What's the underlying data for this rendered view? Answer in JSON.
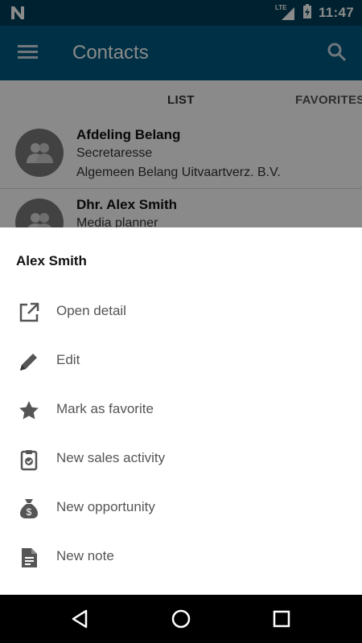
{
  "status_bar": {
    "network_type": "LTE",
    "time": "11:47",
    "icons": [
      "n-notification-icon",
      "signal-lte-icon",
      "battery-charging-icon"
    ]
  },
  "app_bar": {
    "title": "Contacts",
    "background": "#005a80",
    "icons": [
      "menu-icon",
      "search-icon"
    ]
  },
  "tabs": [
    {
      "label": "LIST",
      "selected": true
    },
    {
      "label": "FAVORITES",
      "selected": false
    }
  ],
  "contacts": [
    {
      "name": "Afdeling Belang",
      "role": "Secretaresse",
      "company": "Algemeen Belang Uitvaartverz. B.V."
    },
    {
      "name": "Dhr. Alex Smith",
      "role": "Media planner"
    }
  ],
  "bottom_sheet": {
    "title": "Alex Smith",
    "actions": [
      {
        "label": "Open detail",
        "icon": "open-external-icon"
      },
      {
        "label": "Edit",
        "icon": "pencil-icon"
      },
      {
        "label": "Mark as favorite",
        "icon": "star-icon"
      },
      {
        "label": "New sales activity",
        "icon": "clipboard-check-icon"
      },
      {
        "label": "New opportunity",
        "icon": "money-bag-icon"
      },
      {
        "label": "New note",
        "icon": "note-icon"
      }
    ]
  },
  "nav_bar": {
    "buttons": [
      "back-icon",
      "home-icon",
      "recents-icon"
    ]
  }
}
